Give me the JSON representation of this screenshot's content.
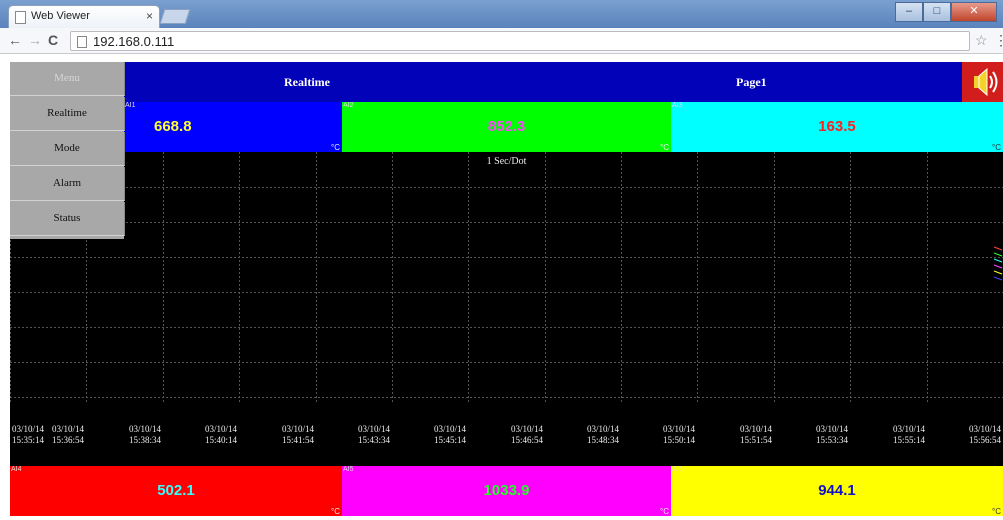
{
  "browser": {
    "tab_title": "Web Viewer",
    "tab_close": "×",
    "url": "192.168.0.111"
  },
  "viewer": {
    "menu": [
      "Menu",
      "Realtime",
      "Mode",
      "Alarm",
      "Status"
    ],
    "header": {
      "left": "Realtime",
      "right": "Page1"
    },
    "rate": "1 Sec/Dot",
    "channels_top": [
      {
        "label": "AI1",
        "value": "668.8",
        "unit": "°C",
        "bg": "#0000ff",
        "fg": "#ffff33"
      },
      {
        "label": "AI2",
        "value": "852.3",
        "unit": "°C",
        "bg": "#00ff00",
        "fg": "#ff44ff"
      },
      {
        "label": "AI3",
        "value": "163.5",
        "unit": "°C",
        "bg": "#00ffff",
        "fg": "#ff2020"
      }
    ],
    "channels_bottom": [
      {
        "label": "AI4",
        "value": "502.1",
        "unit": "°C",
        "bg": "#ff0000",
        "fg": "#33ffff"
      },
      {
        "label": "AI5",
        "value": "1033.9",
        "unit": "°C",
        "bg": "#ff00ff",
        "fg": "#22ff22"
      },
      {
        "label": "AI6",
        "value": "944.1",
        "unit": "°C",
        "bg": "#ffff00",
        "fg": "#1010cc"
      }
    ],
    "time_ticks": [
      [
        "03/10/14",
        "15:35:14"
      ],
      [
        "03/10/14",
        "15:36:54"
      ],
      [
        "03/10/14",
        "15:38:34"
      ],
      [
        "03/10/14",
        "15:40:14"
      ],
      [
        "03/10/14",
        "15:41:54"
      ],
      [
        "03/10/14",
        "15:43:34"
      ],
      [
        "03/10/14",
        "15:45:14"
      ],
      [
        "03/10/14",
        "15:46:54"
      ],
      [
        "03/10/14",
        "15:48:34"
      ],
      [
        "03/10/14",
        "15:50:14"
      ],
      [
        "03/10/14",
        "15:51:54"
      ],
      [
        "03/10/14",
        "15:53:34"
      ],
      [
        "03/10/14",
        "15:55:14"
      ],
      [
        "03/10/14",
        "15:56:54"
      ]
    ]
  }
}
